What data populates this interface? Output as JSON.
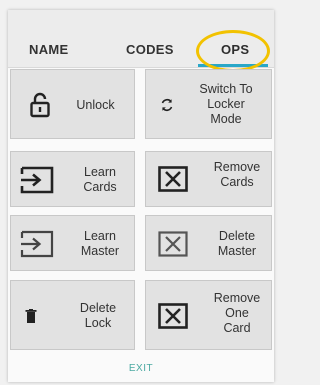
{
  "tabs": {
    "name": "NAME",
    "codes": "CODES",
    "ops": "OPS"
  },
  "buttons": {
    "unlock": "Unlock",
    "switch_locker": [
      "Switch To",
      "Locker",
      "Mode"
    ],
    "learn_cards": [
      "Learn",
      "Cards"
    ],
    "remove_cards": [
      "Remove",
      "Cards"
    ],
    "learn_master": [
      "Learn",
      "Master"
    ],
    "delete_master": [
      "Delete",
      "Master"
    ],
    "delete_lock": [
      "Delete",
      "Lock"
    ],
    "remove_one_card": [
      "Remove",
      "One",
      "Card"
    ]
  },
  "footer": {
    "exit": "EXIT"
  },
  "colors": {
    "tab_underline": "#29a7c8",
    "highlight_ring": "#f2c200",
    "exit_text": "#4aa9a1"
  }
}
